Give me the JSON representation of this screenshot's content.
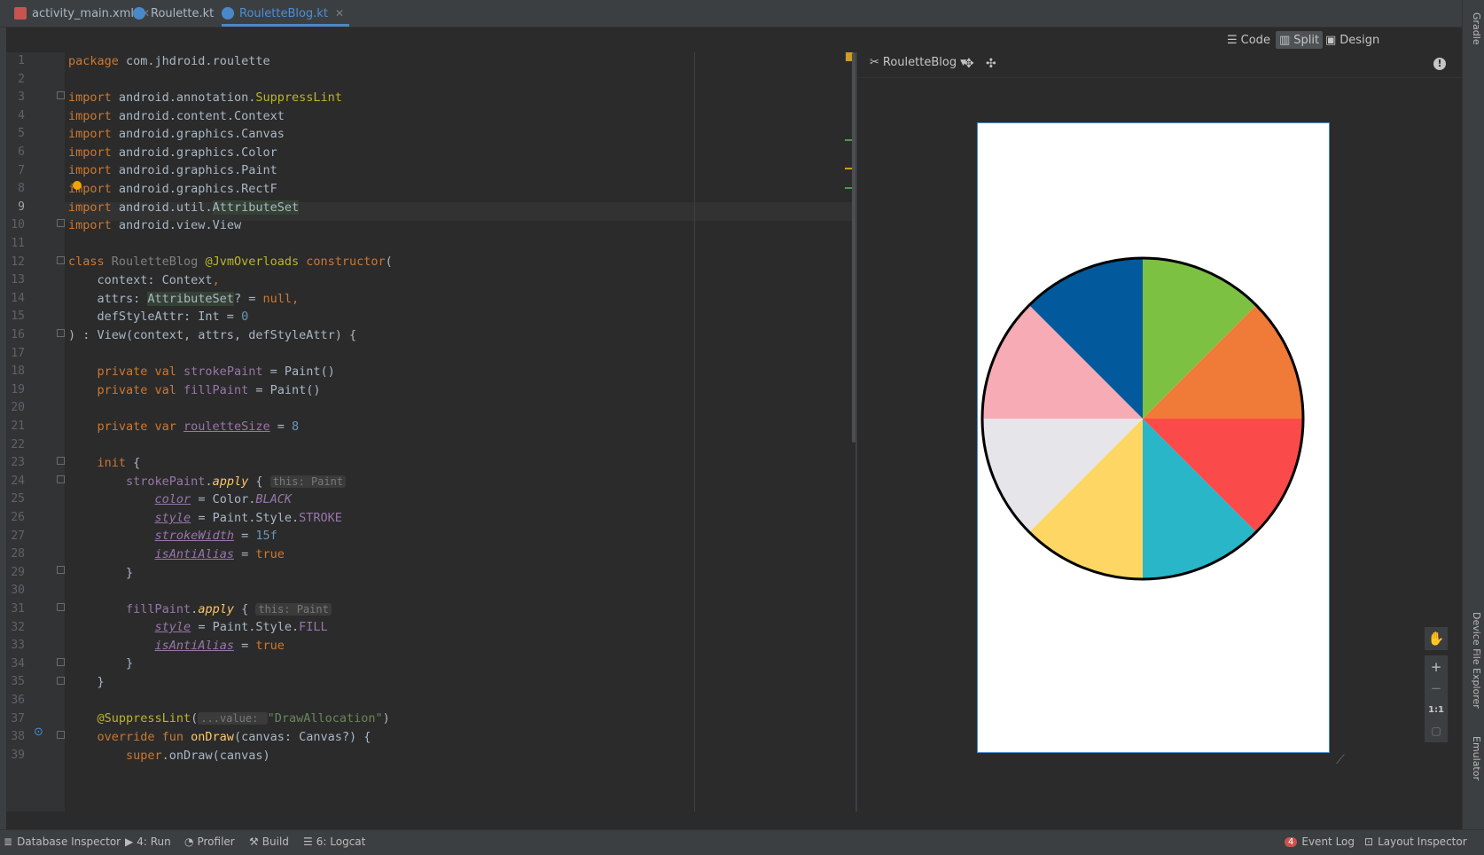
{
  "tabs": [
    {
      "label": "activity_main.xml",
      "active": false
    },
    {
      "label": "Roulette.kt",
      "active": false
    },
    {
      "label": "RouletteBlog.kt",
      "active": true
    }
  ],
  "view_modes": {
    "code": "Code",
    "split": "Split",
    "design": "Design"
  },
  "preview": {
    "component": "RouletteBlog",
    "zoom_label": "1:1"
  },
  "roulette": {
    "segments": 8,
    "colors": [
      "#7dc143",
      "#f07b39",
      "#fa4a4a",
      "#29b6c8",
      "#fdd663",
      "#e6e5ea",
      "#f6abb5",
      "#025a9c"
    ],
    "stroke": "#000000"
  },
  "side_tools": {
    "gradle": "Gradle",
    "device_file_explorer": "Device File Explorer",
    "emulator": "Emulator"
  },
  "status": {
    "database_inspector": "Database Inspector",
    "run": "4: Run",
    "profiler": "Profiler",
    "build": "Build",
    "logcat": "6: Logcat",
    "event_log": "Event Log",
    "event_count": "4",
    "layout_inspector": "Layout Inspector"
  },
  "line_numbers": [
    "1",
    "2",
    "3",
    "4",
    "5",
    "6",
    "7",
    "8",
    "9",
    "10",
    "11",
    "12",
    "13",
    "14",
    "15",
    "16",
    "17",
    "18",
    "19",
    "20",
    "21",
    "22",
    "23",
    "24",
    "25",
    "26",
    "27",
    "28",
    "29",
    "30",
    "31",
    "32",
    "33",
    "34",
    "35",
    "36",
    "37",
    "38",
    "39"
  ],
  "code": {
    "l1": [
      "package ",
      "com.jhdroid.roulette"
    ],
    "l3": [
      "import ",
      "android.annotation.",
      "SuppressLint"
    ],
    "l4": [
      "import ",
      "android.content.Context"
    ],
    "l5": [
      "import ",
      "android.graphics.Canvas"
    ],
    "l6": [
      "import ",
      "android.graphics.Color"
    ],
    "l7": [
      "import ",
      "android.graphics.Paint"
    ],
    "l8": [
      "import ",
      "android.graphics.RectF"
    ],
    "l9": [
      "import ",
      "android.util.",
      "AttributeSet"
    ],
    "l10": [
      "import ",
      "android.view.View"
    ],
    "l12": [
      "class ",
      "RouletteBlog ",
      "@JvmOverloads ",
      "constructor",
      "("
    ],
    "l13": [
      "    context: Context",
      ","
    ],
    "l14": [
      "    attrs: ",
      "AttributeSet",
      "? = ",
      "null",
      ","
    ],
    "l15": [
      "    defStyleAttr: Int = ",
      "0"
    ],
    "l16": [
      ") : View(context, attrs, defStyleAttr) {"
    ],
    "l18": [
      "    private val ",
      "strokePaint",
      " = Paint()"
    ],
    "l19": [
      "    private val ",
      "fillPaint",
      " = Paint()"
    ],
    "l21": [
      "    private var ",
      "rouletteSize",
      " = ",
      "8"
    ],
    "l23": [
      "    init ",
      "{"
    ],
    "l24": [
      "        strokePaint",
      ".",
      "apply",
      " { ",
      "this: Paint"
    ],
    "l25": [
      "            ",
      "color",
      " = Color.",
      "BLACK"
    ],
    "l26": [
      "            ",
      "style",
      " = Paint.Style.",
      "STROKE"
    ],
    "l27": [
      "            ",
      "strokeWidth",
      " = ",
      "15f"
    ],
    "l28": [
      "            ",
      "isAntiAlias",
      " = ",
      "true"
    ],
    "l29": [
      "        }"
    ],
    "l31": [
      "        fillPaint",
      ".",
      "apply",
      " { ",
      "this: Paint"
    ],
    "l32": [
      "            ",
      "style",
      " = Paint.Style.",
      "FILL"
    ],
    "l33": [
      "            ",
      "isAntiAlias",
      " = ",
      "true"
    ],
    "l34": [
      "        }"
    ],
    "l35": [
      "    }"
    ],
    "l37": [
      "    @SuppressLint",
      "(",
      "...value: ",
      "\"DrawAllocation\"",
      ")"
    ],
    "l38": [
      "    override fun ",
      "onDraw",
      "(canvas: Canvas?) {"
    ],
    "l39": [
      "        super",
      ".onDraw(canvas)"
    ]
  }
}
